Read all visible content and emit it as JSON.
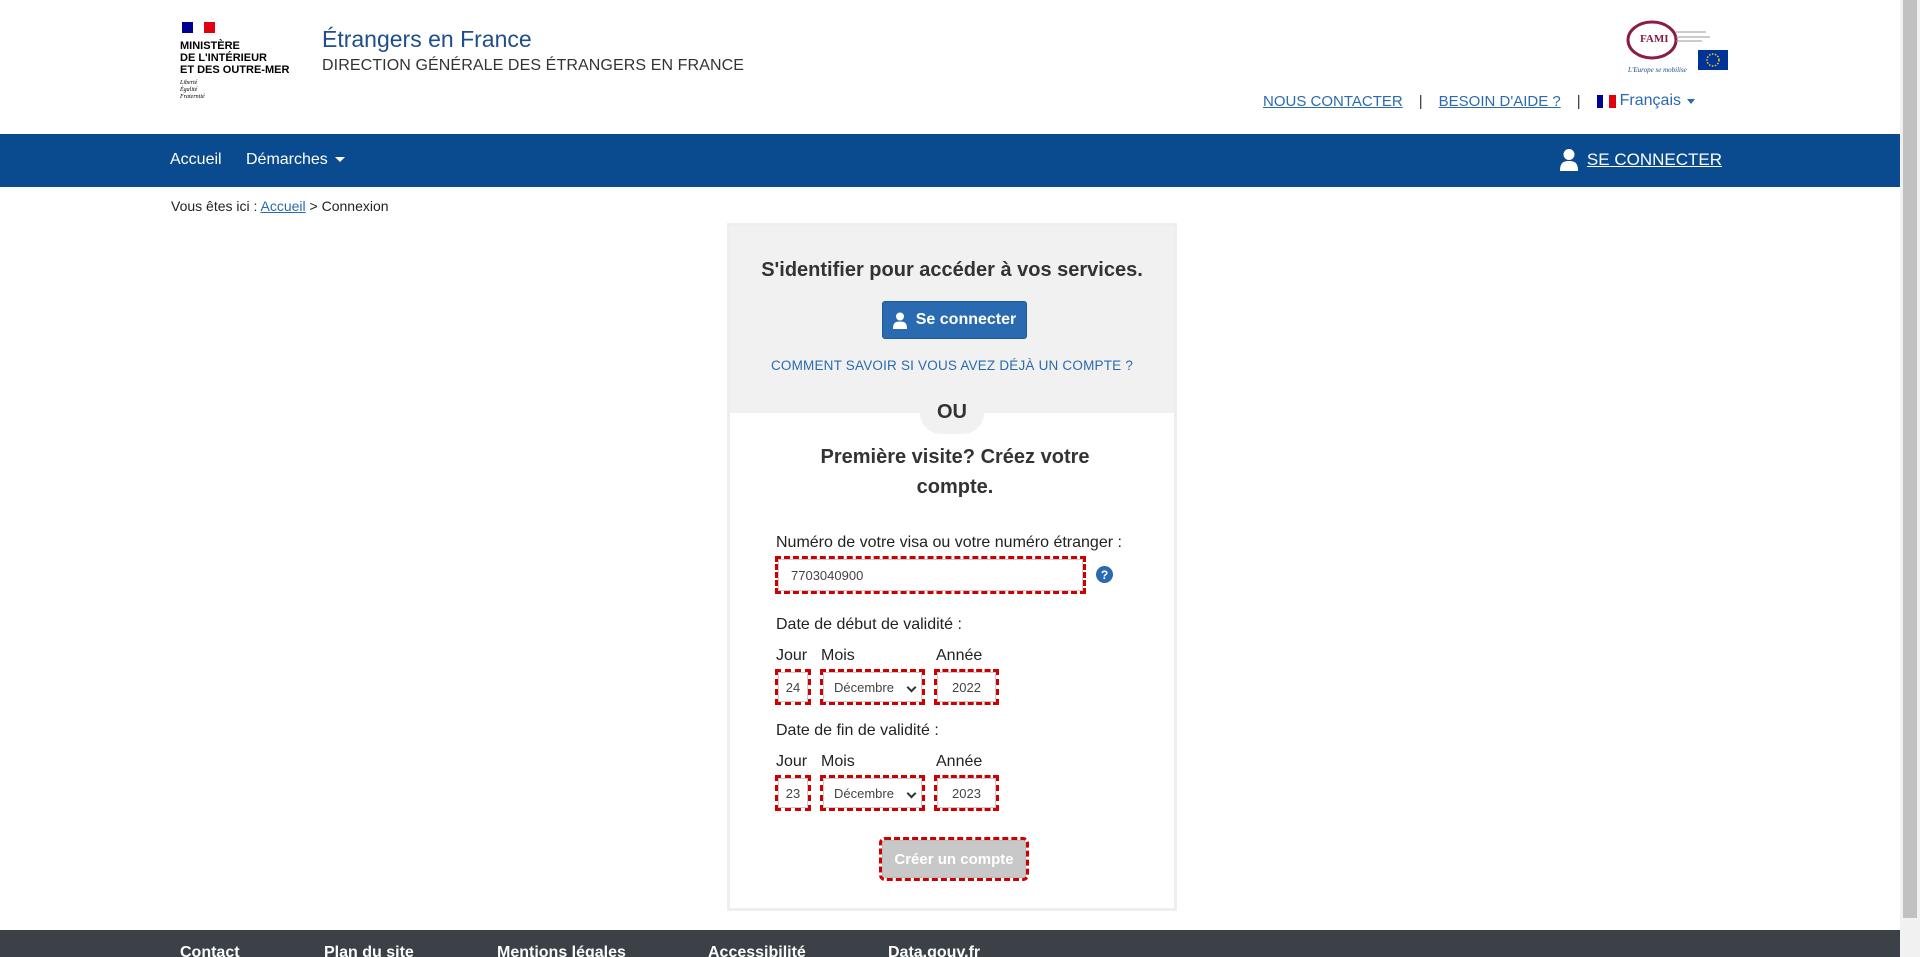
{
  "header": {
    "ministry_name": "MINISTÈRE\nDE L'INTÉRIEUR\nET DES OUTRE-MER",
    "motto": "Liberté\nÉgalité\nFraternité",
    "site_title": "Étrangers en France",
    "site_subtitle": "DIRECTION GÉNÉRALE DES ÉTRANGERS EN FRANCE",
    "fami_logo_text": "FAMI",
    "fami_tagline": "L'Europe se mobilise",
    "links": {
      "contact": "NOUS CONTACTER",
      "help": "BESOIN D'AIDE ?",
      "language": "Français"
    }
  },
  "nav": {
    "home": "Accueil",
    "procedures": "Démarches",
    "login": "SE CONNECTER"
  },
  "breadcrumb": {
    "prefix": "Vous êtes ici : ",
    "home": "Accueil",
    "separator": " > ",
    "current": "Connexion"
  },
  "login_panel": {
    "heading": "S'identifier pour accéder à vos services.",
    "login_button": "Se connecter",
    "account_link": "COMMENT SAVOIR SI VOUS AVEZ DÉJÀ UN COMPTE ?",
    "or_label": "OU",
    "first_visit_title": "Première visite? Créez votre compte.",
    "visa_label": "Numéro de votre visa ou votre numéro étranger :",
    "visa_value": "7703040900",
    "start_date_label": "Date de début de validité :",
    "end_date_label": "Date de fin de validité :",
    "day_label": "Jour",
    "month_label": "Mois",
    "year_label": "Année",
    "start": {
      "day": "24",
      "month": "Décembre",
      "year": "2022"
    },
    "end": {
      "day": "23",
      "month": "Décembre",
      "year": "2023"
    },
    "create_button": "Créer un compte"
  },
  "footer": {
    "links": [
      "Contact",
      "Plan du site",
      "Mentions légales",
      "Accessibilité",
      "Data.gouv.fr"
    ]
  },
  "colors": {
    "brand_blue": "#0a4a8e",
    "link_blue": "#2a6ab0",
    "highlight_red": "#cc0000",
    "footer_bg": "#3b4147"
  }
}
